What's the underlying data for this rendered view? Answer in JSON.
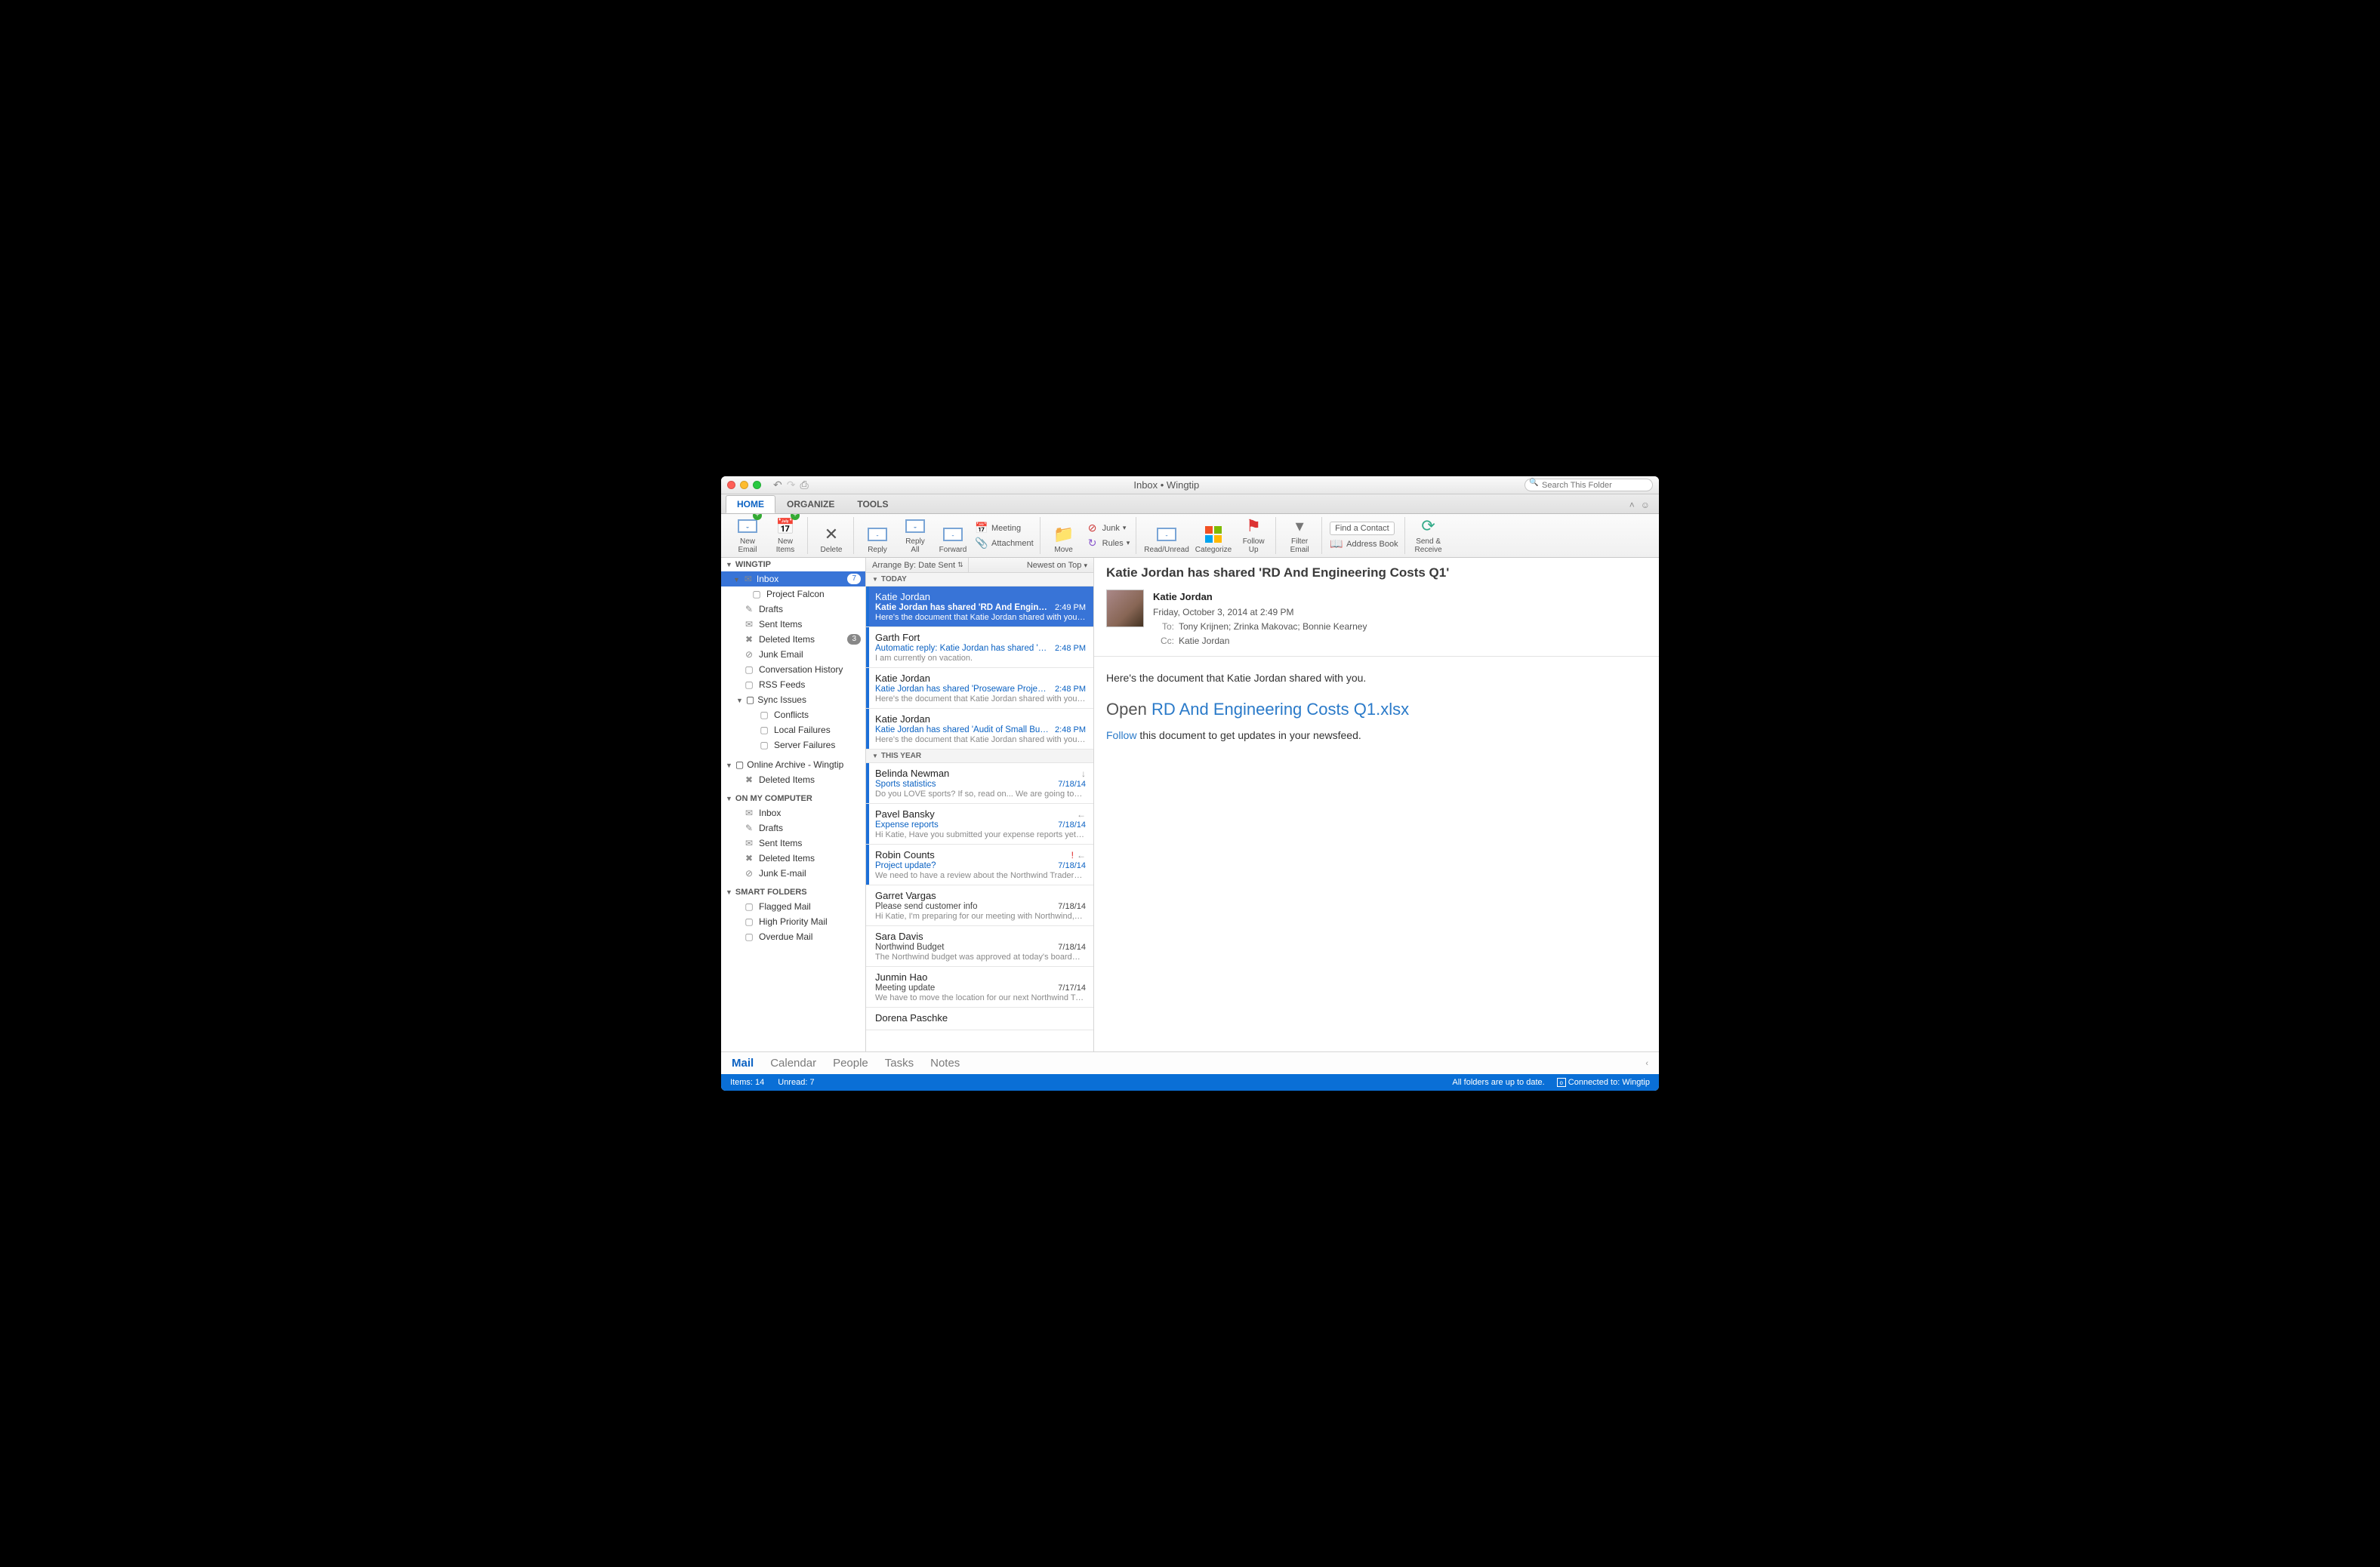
{
  "titlebar": {
    "title": "Inbox • Wingtip",
    "search_placeholder": "Search This Folder"
  },
  "tabs": {
    "home": "HOME",
    "organize": "ORGANIZE",
    "tools": "TOOLS"
  },
  "ribbon": {
    "new_email": "New\nEmail",
    "new_items": "New\nItems",
    "delete": "Delete",
    "reply": "Reply",
    "reply_all": "Reply\nAll",
    "forward": "Forward",
    "meeting": "Meeting",
    "attachment": "Attachment",
    "move": "Move",
    "junk": "Junk",
    "rules": "Rules",
    "read_unread": "Read/Unread",
    "categorize": "Categorize",
    "follow_up": "Follow\nUp",
    "filter_email": "Filter\nEmail",
    "find_contact": "Find a Contact",
    "address_book": "Address Book",
    "send_receive": "Send &\nReceive"
  },
  "tree": {
    "account": "WINGTIP",
    "inbox": "Inbox",
    "inbox_count": "7",
    "project_falcon": "Project Falcon",
    "drafts": "Drafts",
    "sent": "Sent Items",
    "deleted": "Deleted Items",
    "deleted_count": "3",
    "junk": "Junk Email",
    "conv": "Conversation History",
    "rss": "RSS Feeds",
    "sync": "Sync Issues",
    "conflicts": "Conflicts",
    "localfail": "Local Failures",
    "serverfail": "Server Failures",
    "archive_hdr": "Online Archive - Wingtip",
    "archive_deleted": "Deleted Items",
    "onmy_hdr": "ON MY COMPUTER",
    "om_inbox": "Inbox",
    "om_drafts": "Drafts",
    "om_sent": "Sent Items",
    "om_deleted": "Deleted Items",
    "om_junk": "Junk E-mail",
    "smart_hdr": "SMART FOLDERS",
    "flagged": "Flagged Mail",
    "highpri": "High Priority Mail",
    "overdue": "Overdue Mail"
  },
  "arrange": {
    "by": "Arrange By: Date Sent",
    "sort": "Newest on Top"
  },
  "groups": {
    "today": "TODAY",
    "year": "THIS YEAR"
  },
  "messages": [
    {
      "from": "Katie Jordan",
      "subject": "Katie Jordan has shared 'RD And Engineeri…",
      "time": "2:49 PM",
      "preview": "Here's the document that Katie Jordan shared with you…",
      "unread": true,
      "selected": true,
      "group": "today"
    },
    {
      "from": "Garth Fort",
      "subject": "Automatic reply: Katie Jordan has shared '…",
      "time": "2:48 PM",
      "preview": "I am currently on vacation.",
      "unread": true,
      "group": "today"
    },
    {
      "from": "Katie Jordan",
      "subject": "Katie Jordan has shared 'Proseware Projec…",
      "time": "2:48 PM",
      "preview": "Here's the document that Katie Jordan shared with you…",
      "unread": true,
      "group": "today"
    },
    {
      "from": "Katie Jordan",
      "subject": "Katie Jordan has shared 'Audit of Small Bu…",
      "time": "2:48 PM",
      "preview": "Here's the document that Katie Jordan shared with you…",
      "unread": true,
      "group": "today"
    },
    {
      "from": "Belinda Newman",
      "subject": "Sports statistics",
      "time": "7/18/14",
      "preview": "Do you LOVE sports? If so, read on... We are going to…",
      "unread": true,
      "group": "year",
      "flag_fwd": true
    },
    {
      "from": "Pavel Bansky",
      "subject": "Expense reports",
      "time": "7/18/14",
      "preview": "Hi Katie, Have you submitted your expense reports yet…",
      "unread": true,
      "group": "year",
      "flag_reply": true
    },
    {
      "from": "Robin Counts",
      "subject": "Project update?",
      "time": "7/18/14",
      "preview": "We need to have a review about the Northwind Traders…",
      "unread": true,
      "group": "year",
      "flag_important": true,
      "flag_reply": true
    },
    {
      "from": "Garret Vargas",
      "subject": "Please send customer info",
      "time": "7/18/14",
      "preview": "Hi Katie, I'm preparing for our meeting with Northwind,…",
      "unread": false,
      "group": "year"
    },
    {
      "from": "Sara Davis",
      "subject": "Northwind Budget",
      "time": "7/18/14",
      "preview": "The Northwind budget was approved at today's board…",
      "unread": false,
      "group": "year"
    },
    {
      "from": "Junmin Hao",
      "subject": "Meeting update",
      "time": "7/17/14",
      "preview": "We have to move the location for our next Northwind Tr…",
      "unread": false,
      "group": "year"
    },
    {
      "from": "Dorena Paschke",
      "subject": "",
      "time": "",
      "preview": "",
      "unread": false,
      "group": "year"
    }
  ],
  "reading": {
    "subject": "Katie Jordan has shared 'RD And Engineering Costs Q1'",
    "from": "Katie Jordan",
    "date": "Friday, October 3, 2014 at 2:49 PM",
    "to_label": "To:",
    "to": "Tony Krijnen;   Zrinka Makovac;   Bonnie Kearney",
    "cc_label": "Cc:",
    "cc": "Katie Jordan",
    "body_intro": "Here's the document that Katie Jordan shared with you.",
    "open_prefix": "Open ",
    "open_link": "RD And Engineering Costs Q1.xlsx",
    "follow_link": "Follow",
    "follow_rest": " this document to get updates in your newsfeed."
  },
  "bottomnav": {
    "mail": "Mail",
    "calendar": "Calendar",
    "people": "People",
    "tasks": "Tasks",
    "notes": "Notes"
  },
  "status": {
    "items": "Items: 14",
    "unread": "Unread: 7",
    "syncmsg": "All folders are up to date.",
    "connected": "Connected to: Wingtip"
  }
}
